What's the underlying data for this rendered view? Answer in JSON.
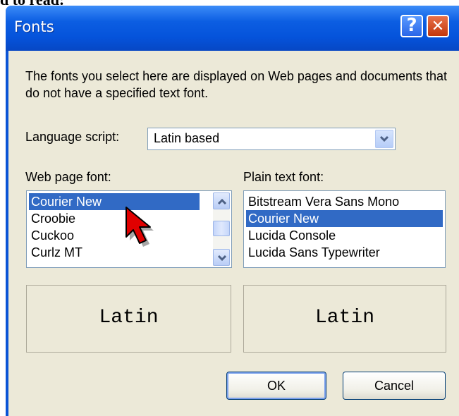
{
  "fragment": "d to read:",
  "window": {
    "title": "Fonts",
    "help_glyph": "?",
    "close_glyph": "✕"
  },
  "description": "The fonts you select here are displayed on Web pages and documents that do not have a specified text font.",
  "language_script": {
    "label": "Language script:",
    "value": "Latin based"
  },
  "web_page_font": {
    "label": "Web page font:",
    "items": [
      "Courier New",
      "Croobie",
      "Cuckoo",
      "Curlz MT"
    ],
    "selected": "Courier New",
    "preview": "Latin"
  },
  "plain_text_font": {
    "label": "Plain text font:",
    "items": [
      "Bitstream Vera Sans Mono",
      "Courier New",
      "Lucida Console",
      "Lucida Sans Typewriter"
    ],
    "selected": "Courier New",
    "preview": "Latin"
  },
  "buttons": {
    "ok": "OK",
    "cancel": "Cancel"
  },
  "icons": {
    "help": "help-icon",
    "close": "close-icon",
    "dropdown": "chevron-down-icon",
    "scroll_up": "chevron-up-icon",
    "scroll_down": "chevron-down-icon",
    "cursor": "mouse-cursor-icon"
  },
  "colors": {
    "titlebar": "#0553db",
    "client": "#ece9d8",
    "selection": "#316ac5",
    "close_button": "#c2370c",
    "cursor": "#e00000"
  }
}
